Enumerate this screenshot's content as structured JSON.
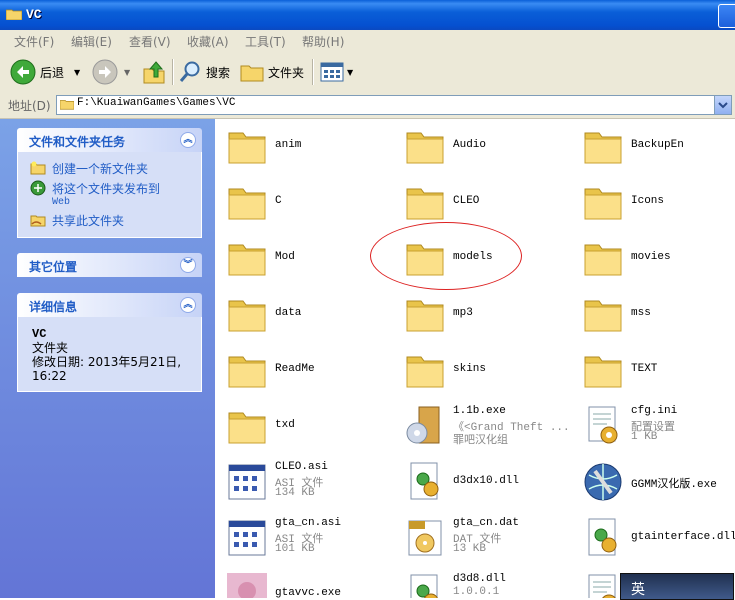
{
  "window": {
    "title": "VC"
  },
  "menu": [
    "文件(F)",
    "编辑(E)",
    "查看(V)",
    "收藏(A)",
    "工具(T)",
    "帮助(H)"
  ],
  "toolbar": {
    "back": "后退",
    "search": "搜索",
    "folders": "文件夹"
  },
  "address": {
    "label": "地址(D)",
    "path": "F:\\KuaiwanGames\\Games\\VC"
  },
  "tasks_panel": {
    "title": "文件和文件夹任务",
    "items": [
      {
        "label": "创建一个新文件夹",
        "sub": ""
      },
      {
        "label": "将这个文件夹发布到",
        "sub": "Web"
      },
      {
        "label": "共享此文件夹",
        "sub": ""
      }
    ]
  },
  "places_panel": {
    "title": "其它位置"
  },
  "details_panel": {
    "title": "详细信息",
    "name": "VC",
    "type": "文件夹",
    "modified": "修改日期: 2013年5月21日, 16:22"
  },
  "files": [
    {
      "name": "anim",
      "kind": "folder"
    },
    {
      "name": "Audio",
      "kind": "folder"
    },
    {
      "name": "BackupEn",
      "kind": "folder"
    },
    {
      "name": "C",
      "kind": "folder"
    },
    {
      "name": "CLEO",
      "kind": "folder"
    },
    {
      "name": "Icons",
      "kind": "folder"
    },
    {
      "name": "Mod",
      "kind": "folder"
    },
    {
      "name": "models",
      "kind": "folder"
    },
    {
      "name": "movies",
      "kind": "folder"
    },
    {
      "name": "data",
      "kind": "folder"
    },
    {
      "name": "mp3",
      "kind": "folder"
    },
    {
      "name": "mss",
      "kind": "folder"
    },
    {
      "name": "ReadMe",
      "kind": "folder"
    },
    {
      "name": "skins",
      "kind": "folder"
    },
    {
      "name": "TEXT",
      "kind": "folder"
    },
    {
      "name": "txd",
      "kind": "folder"
    },
    {
      "name": "1.1b.exe",
      "kind": "installer",
      "line2": "《<Grand Theft ...",
      "line3": "罪吧汉化组"
    },
    {
      "name": "cfg.ini",
      "kind": "config",
      "line2": "配置设置",
      "line3": "1 KB"
    },
    {
      "name": "CLEO.asi",
      "kind": "doc",
      "line2": "ASI 文件",
      "line3": "134 KB"
    },
    {
      "name": "d3dx10.dll",
      "kind": "dll"
    },
    {
      "name": "GGMM汉化版.exe",
      "kind": "globe"
    },
    {
      "name": "gta_cn.asi",
      "kind": "doc",
      "line2": "ASI 文件",
      "line3": "101 KB"
    },
    {
      "name": "gta_cn.dat",
      "kind": "dat",
      "line2": "DAT 文件",
      "line3": "13 KB"
    },
    {
      "name": "gtainterface.dll",
      "kind": "dll"
    },
    {
      "name": "gtavvc.exe",
      "kind": "photo"
    },
    {
      "name": "d3d8.dll",
      "kind": "dll",
      "line2": "1.0.0.1"
    },
    {
      "name": "",
      "kind": "config"
    }
  ],
  "ime": {
    "label": "英"
  },
  "colors": {
    "titlebar": "#0a5fd8",
    "panel_blue": "#7ba2e7",
    "link": "#215dc6",
    "annotation": "#dd2222"
  }
}
